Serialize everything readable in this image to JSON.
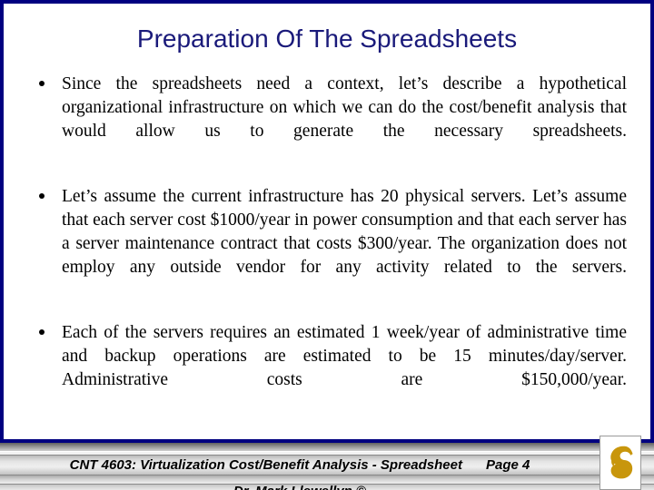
{
  "slide": {
    "title": "Preparation Of The Spreadsheets",
    "accent_navy": "#000080",
    "title_color": "#1a1a7a",
    "logo_gold": "#C8960C",
    "background": "#FFFFFF"
  },
  "bullets": [
    {
      "marker": "bullet-dot",
      "text": "Since the spreadsheets need a context, let’s describe a hypothetical organizational infrastructure on which we can do the cost/benefit analysis that would allow us to generate the necessary spreadsheets."
    },
    {
      "marker": "bullet-dot",
      "text": "Let’s assume the current infrastructure has 20 physical servers.  Let’s assume that each server cost $1000/year in power consumption and that each server has a server maintenance contract that costs $300/year.  The organization does not employ any outside vendor for any activity related to the servers."
    },
    {
      "marker": "bullet-dot",
      "text": "Each of the servers requires an estimated 1 week/year of administrative time and backup operations are estimated to be 15 minutes/day/server.  Administrative costs are $150,000/year."
    }
  ],
  "footer": {
    "course": "CNT 4603: Virtualization Cost/Benefit Analysis - Spreadsheet",
    "page": "Page 4",
    "author": "Dr. Mark Llewellyn ©",
    "logo_name": "ucf-pegasus-logo"
  }
}
